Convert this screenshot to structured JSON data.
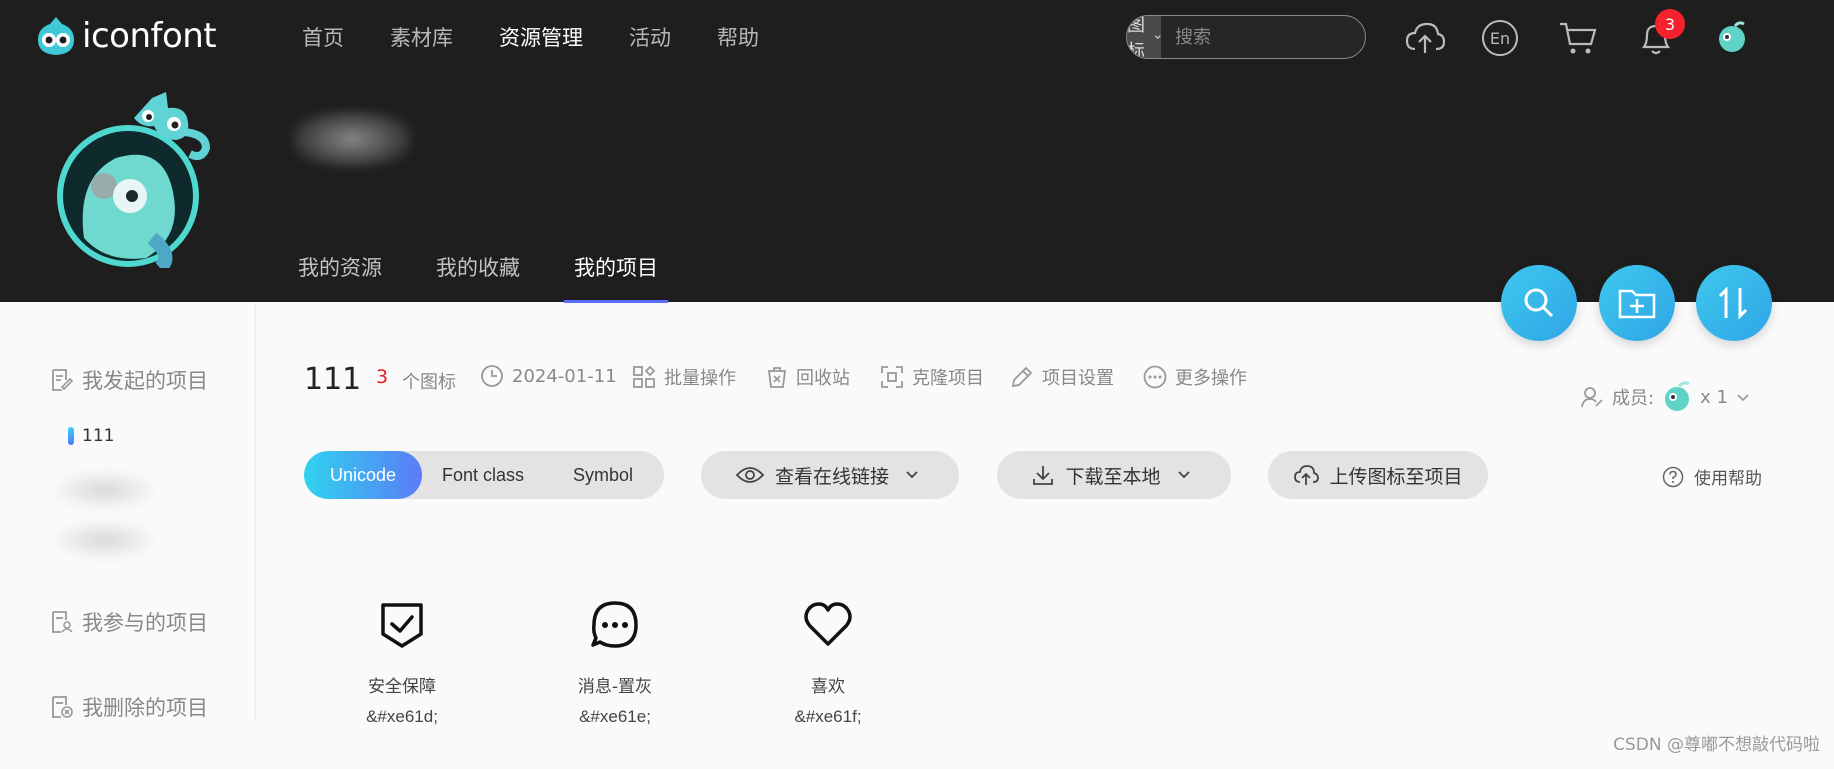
{
  "brand": {
    "name": "iconfont"
  },
  "nav": {
    "items": [
      {
        "label": "首页"
      },
      {
        "label": "素材库"
      },
      {
        "label": "资源管理"
      },
      {
        "label": "活动"
      },
      {
        "label": "帮助"
      }
    ],
    "active": "资源管理"
  },
  "search": {
    "type_label": "图标",
    "placeholder": "搜索"
  },
  "header_icons": {
    "upload": "upload-cloud-icon",
    "language": "En",
    "cart": "cart-icon",
    "notifications": "bell-icon",
    "notification_count": "3",
    "avatar": "user-avatar"
  },
  "profile": {
    "tabs": [
      {
        "label": "我的资源"
      },
      {
        "label": "我的收藏"
      },
      {
        "label": "我的项目"
      }
    ],
    "active_tab": "我的项目"
  },
  "fab": {
    "items": [
      "search-icon",
      "new-folder-icon",
      "sort-icon"
    ]
  },
  "sidebar": {
    "created_label": "我发起的项目",
    "selected_project": "111",
    "joined_label": "我参与的项目",
    "deleted_label": "我删除的项目"
  },
  "project": {
    "name": "111",
    "icon_count": "3",
    "icon_count_unit": "个图标",
    "date": "2024-01-11",
    "batch": "批量操作",
    "recycle": "回收站",
    "clone": "克隆项目",
    "settings": "项目设置",
    "more": "更多操作",
    "members_label": "成员:",
    "members_count": "x 1"
  },
  "toolbar": {
    "formats": [
      "Unicode",
      "Font class",
      "Symbol"
    ],
    "active_format": "Unicode",
    "view_link": "查看在线链接",
    "download": "下载至本地",
    "upload": "上传图标至项目",
    "help": "使用帮助"
  },
  "icons": [
    {
      "name": "安全保障",
      "code": "&#xe61d;",
      "icon": "shield-check-icon"
    },
    {
      "name": "消息-置灰",
      "code": "&#xe61e;",
      "icon": "chat-bubble-icon"
    },
    {
      "name": "喜欢",
      "code": "&#xe61f;",
      "icon": "heart-icon"
    }
  ],
  "watermark": "CSDN @尊嘟不想敲代码啦",
  "colors": {
    "header_bg": "#1e1e1e",
    "accent": "#5b6cff",
    "fab": "#3ec8ee",
    "badge": "#f5222d",
    "count": "#e02020"
  }
}
